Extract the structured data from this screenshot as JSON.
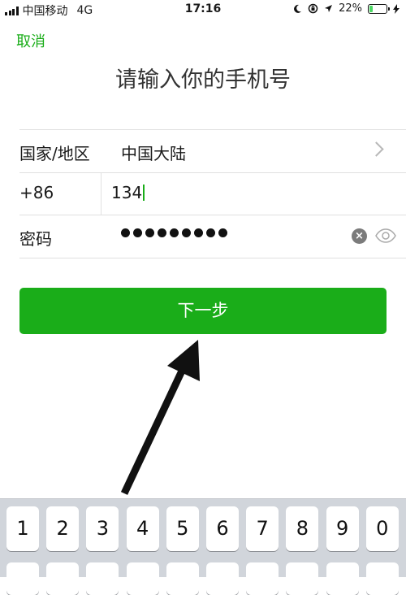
{
  "status_bar": {
    "carrier": "中国移动",
    "network": "4G",
    "time": "17:16",
    "battery": "22%",
    "battery_level": 0.22
  },
  "header": {
    "cancel_label": "取消",
    "title": "请输入你的手机号"
  },
  "form": {
    "country_label": "国家/地区",
    "country_value": "中国大陆",
    "country_code": "+86",
    "phone_value": "134",
    "password_label": "密码",
    "password_dots": 9
  },
  "next_button_label": "下一步",
  "keyboard": {
    "keys": [
      "1",
      "2",
      "3",
      "4",
      "5",
      "6",
      "7",
      "8",
      "9",
      "0"
    ]
  },
  "colors": {
    "accent": "#1aad19",
    "keyboard_bg": "#d1d5db"
  }
}
